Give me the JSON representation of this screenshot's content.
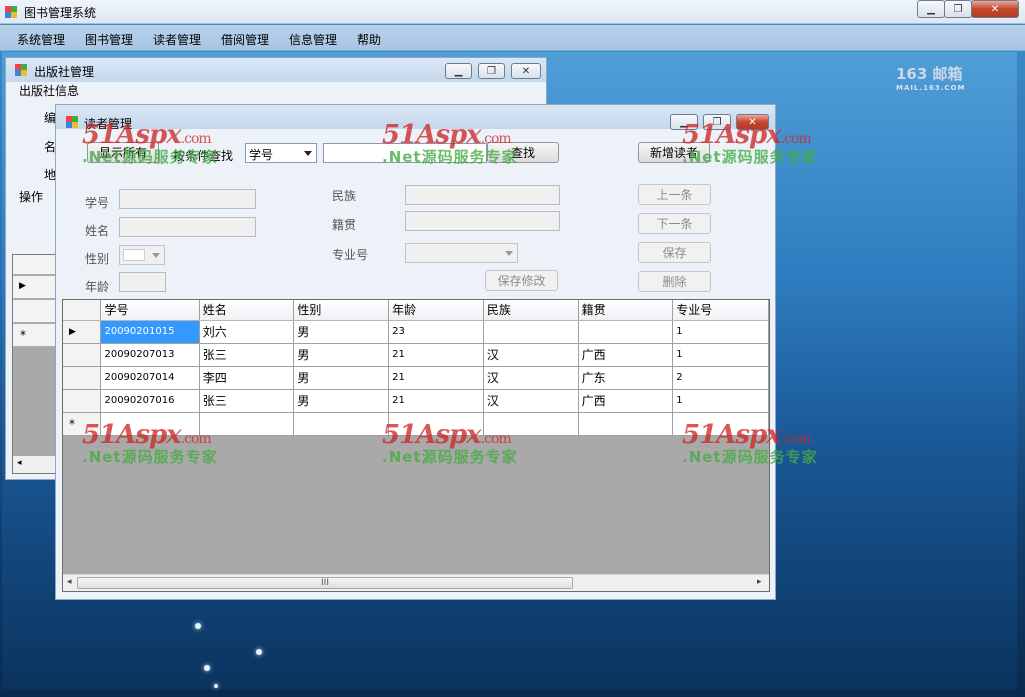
{
  "app": {
    "title": "图书管理系统",
    "menu": [
      "系统管理",
      "图书管理",
      "读者管理",
      "借阅管理",
      "信息管理",
      "帮助"
    ]
  },
  "desktop": {
    "brand_main": "163 邮箱",
    "brand_sub": "MAIL.163.COM"
  },
  "publisher_window": {
    "title": "出版社管理",
    "group_label": "出版社信息",
    "label_bian": "编",
    "label_ming": "名",
    "label_di": "地",
    "ops_label": "操作"
  },
  "reader_window": {
    "title": "读者管理",
    "show_all_label": "显示所有",
    "search_by_label": "按条件查找",
    "search_field": "学号",
    "search_button": "查找",
    "new_reader_button": "新增读者",
    "fields": {
      "student_id": "学号",
      "name": "姓名",
      "gender": "性别",
      "age": "年龄",
      "ethnicity": "民族",
      "native_place": "籍贯",
      "major_no": "专业号"
    },
    "buttons": {
      "prev": "上一条",
      "next": "下一条",
      "save": "保存",
      "delete": "删除",
      "save_edit": "保存修改"
    },
    "grid": {
      "columns": [
        "学号",
        "姓名",
        "性别",
        "年龄",
        "民族",
        "籍贯",
        "专业号"
      ],
      "rows": [
        [
          "20090201015",
          "刘六",
          "男",
          "23",
          "",
          "",
          "1"
        ],
        [
          "20090207013",
          "张三",
          "男",
          "21",
          "汉",
          "广西",
          "1"
        ],
        [
          "20090207014",
          "李四",
          "男",
          "21",
          "汉",
          "广东",
          "2"
        ],
        [
          "20090207016",
          "张三",
          "男",
          "21",
          "汉",
          "广西",
          "1"
        ]
      ],
      "new_row_marker": "*",
      "scroll_thumb": "III"
    }
  },
  "watermark": {
    "logo": "51Aspx",
    "tld": ".com",
    "tagline": ".Net源码服务专家"
  },
  "colors": {
    "selection": "#3399ff",
    "menubar": "#b9d1ea",
    "close": "#c4462e"
  }
}
